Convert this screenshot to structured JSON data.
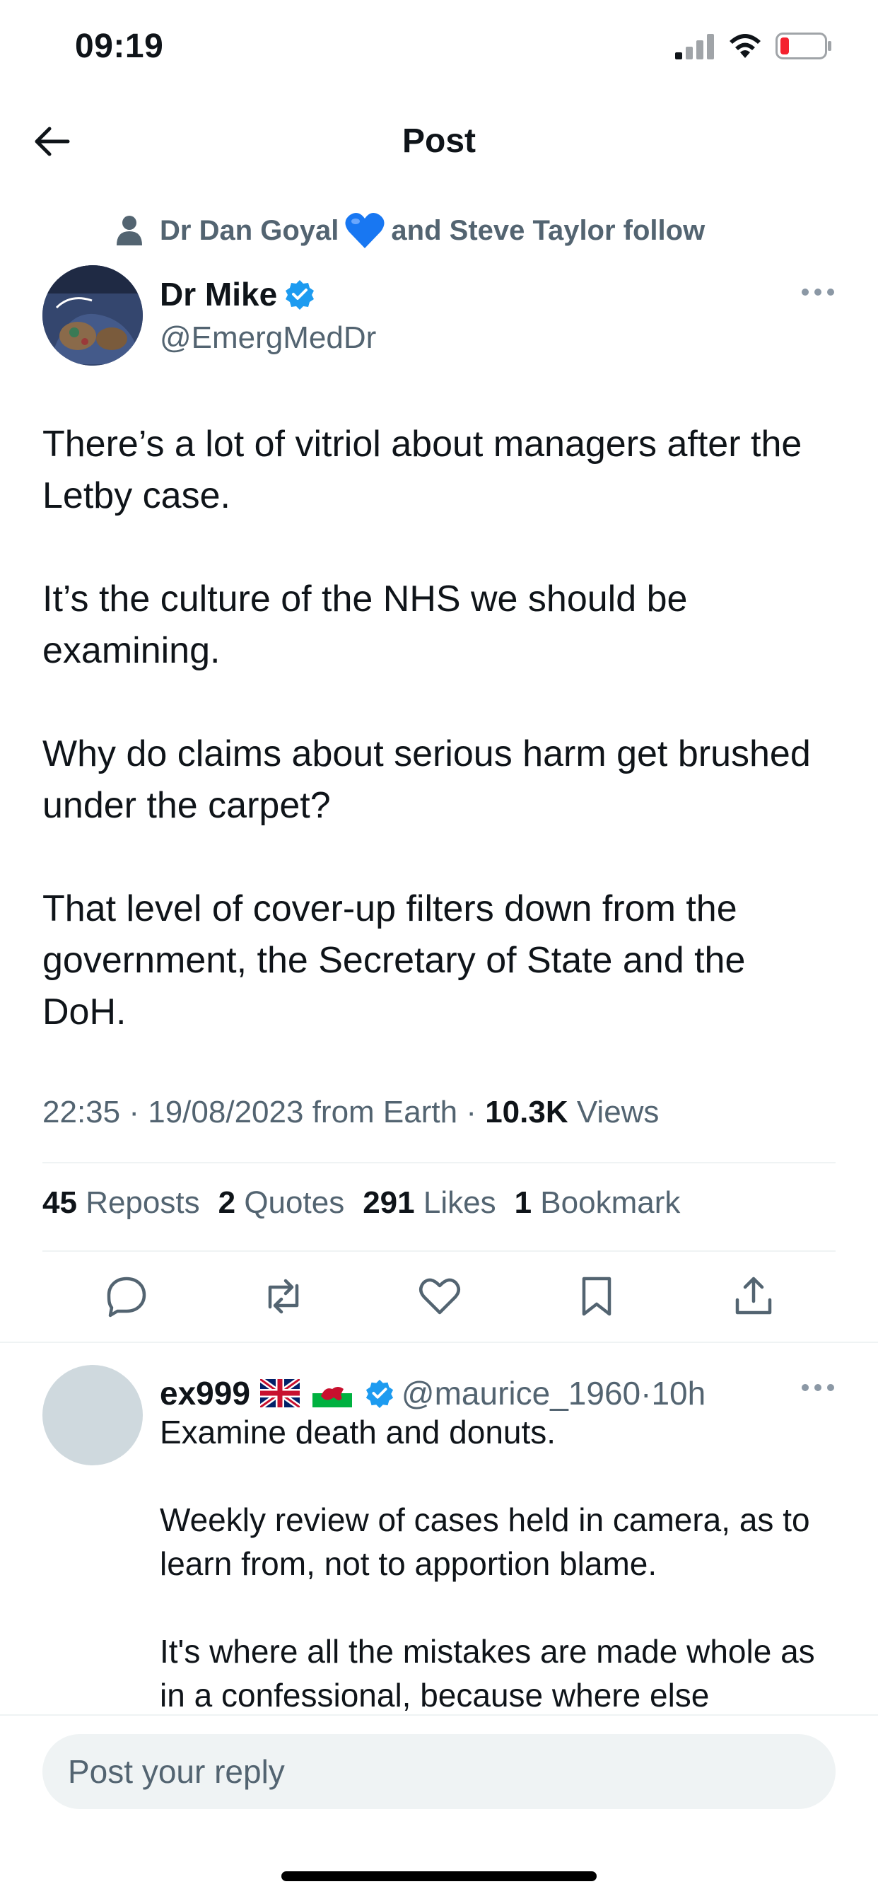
{
  "status_bar": {
    "time": "09:19"
  },
  "nav": {
    "title": "Post"
  },
  "social_context": {
    "first_name": "Dr Dan Goyal",
    "rest": "and Steve Taylor follow"
  },
  "tweet": {
    "author_name": "Dr Mike",
    "author_handle": "@EmergMedDr",
    "paragraphs": [
      "There’s a lot of vitriol about managers after the Letby case.",
      "It’s the culture of the NHS we should be examining.",
      "Why do claims about serious harm get brushed under the carpet?",
      "That level of cover-up filters down from the government, the Secretary of State and the DoH."
    ],
    "meta": {
      "time": "22:35",
      "date": "19/08/2023",
      "source": "from Earth",
      "views_count": "10.3K",
      "views_label": "Views"
    },
    "stats": {
      "reposts_count": "45",
      "reposts_label": "Reposts",
      "quotes_count": "2",
      "quotes_label": "Quotes",
      "likes_count": "291",
      "likes_label": "Likes",
      "bookmarks_count": "1",
      "bookmarks_label": "Bookmark"
    }
  },
  "reply": {
    "name": "ex999",
    "handle": "@maurice_1960",
    "age": "10h",
    "paragraphs": [
      "Examine death and donuts.",
      "Weekly review of cases held in camera, as to learn from, not to apportion blame.",
      "It's where all the mistakes are made whole as in a confessional, because where else"
    ]
  },
  "composer": {
    "placeholder": "Post your reply"
  },
  "colors": {
    "accent": "#1d9bf0",
    "text_primary": "#0f1419",
    "text_secondary": "#536471",
    "divider": "#eff3f4",
    "battery_low": "#f4212e"
  }
}
